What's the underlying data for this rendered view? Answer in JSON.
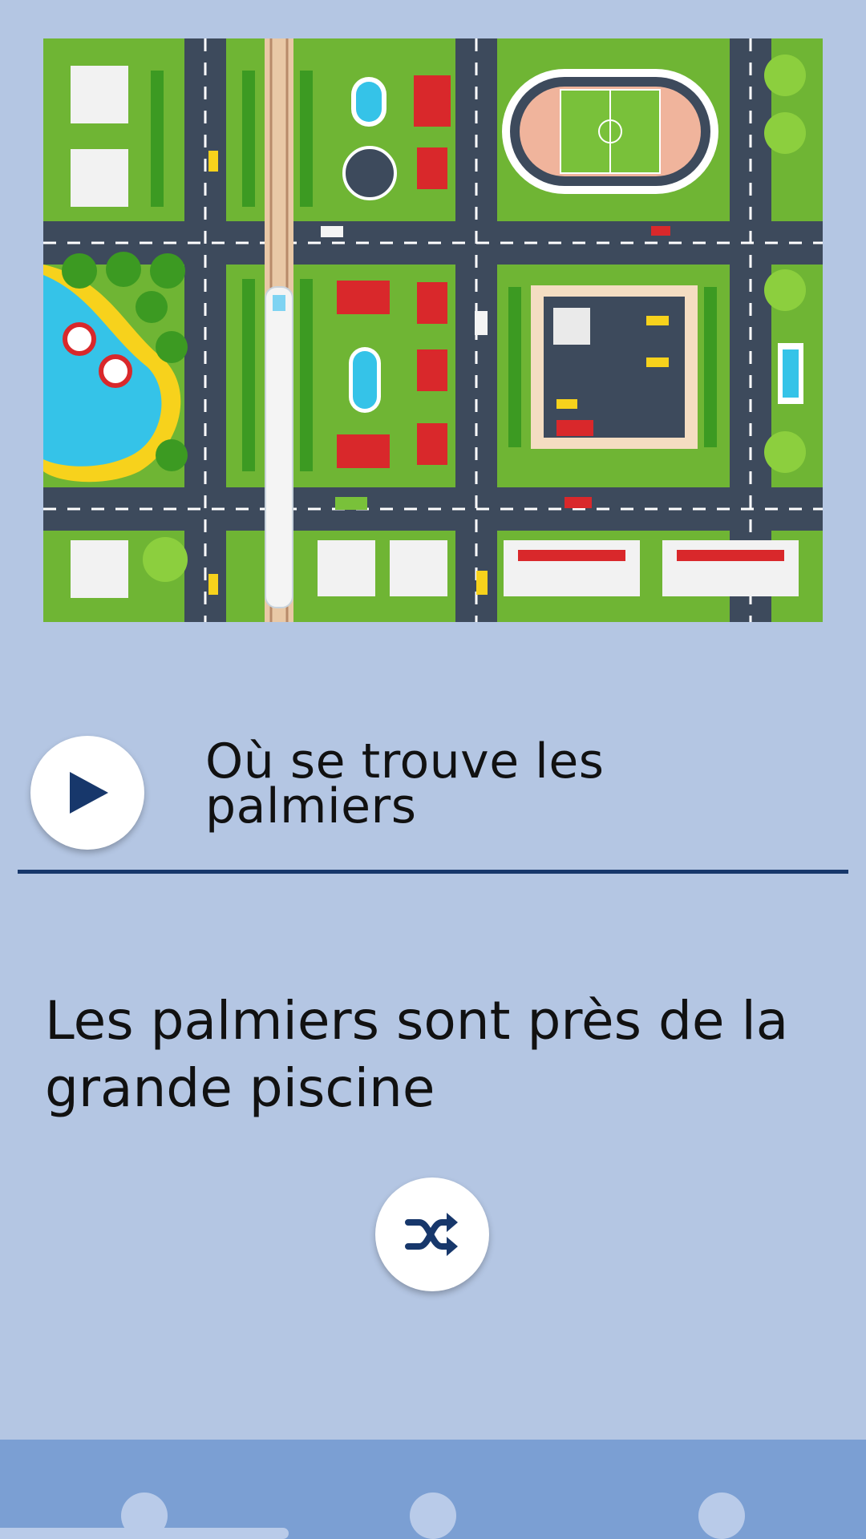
{
  "map": {
    "image_name": "city-map-illustration",
    "colors": {
      "grass": "#6fb534",
      "road": "#3d4a5c",
      "water": "#35c3e8",
      "sand": "#f7d21c",
      "roof": "#d9282b"
    }
  },
  "question": {
    "play_icon": "play-icon",
    "text": "Où se trouve les palmiers"
  },
  "answer": {
    "text": "Les palmiers sont près de la grande piscine"
  },
  "shuffle": {
    "icon": "shuffle-icon"
  },
  "nav": {
    "items": [
      "nav-dot-1",
      "nav-dot-2",
      "nav-dot-3"
    ],
    "active_index": 0
  },
  "colors": {
    "background": "#b4c6e3",
    "accent": "#17376b",
    "nav_bar": "#7b9fd3"
  }
}
